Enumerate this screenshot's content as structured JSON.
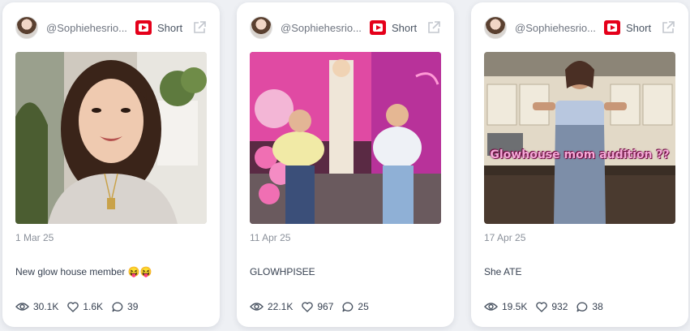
{
  "colors": {
    "accent_red": "#e5001a",
    "card_bg": "#ffffff",
    "page_bg": "#eef0f4"
  },
  "posts": [
    {
      "handle": "@Sophiehesrio...",
      "platform_icon": "youtube-icon",
      "type_label": "Short",
      "date": "1 Mar 25",
      "caption": "New glow house member 😝😝",
      "overlay_text": "",
      "stats": {
        "views": "30.1K",
        "likes": "1.6K",
        "comments": "39"
      }
    },
    {
      "handle": "@Sophiehesrio...",
      "platform_icon": "youtube-icon",
      "type_label": "Short",
      "date": "11 Apr 25",
      "caption": "GLOWHPISEE",
      "overlay_text": "",
      "stats": {
        "views": "22.1K",
        "likes": "967",
        "comments": "25"
      }
    },
    {
      "handle": "@Sophiehesrio...",
      "platform_icon": "youtube-icon",
      "type_label": "Short",
      "date": "17 Apr 25",
      "caption": "She ATE",
      "overlay_text": "Glowhouse mom audition ??",
      "stats": {
        "views": "19.5K",
        "likes": "932",
        "comments": "38"
      }
    }
  ]
}
